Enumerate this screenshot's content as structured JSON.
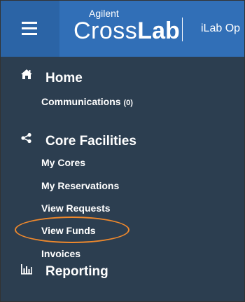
{
  "header": {
    "brand_small": "Agilent",
    "brand_light": "Cross",
    "brand_bold": "Lab",
    "app_title": "iLab Op",
    "menu_icon": "hamburger-menu-icon",
    "colors": {
      "header_bg": "#316fb7",
      "menu_button_bg": "#2b64a6",
      "text": "#ffffff"
    }
  },
  "sidebar": {
    "colors": {
      "bg": "#2c3e50",
      "text": "#ffffff",
      "highlight": "#f0892c"
    },
    "sections": [
      {
        "label": "Home",
        "icon": "home-icon",
        "items": [
          {
            "label": "Communications",
            "count": "(0)"
          }
        ]
      },
      {
        "label": "Core Facilities",
        "icon": "share-icon",
        "items": [
          {
            "label": "My Cores"
          },
          {
            "label": "My Reservations"
          },
          {
            "label": "View Requests"
          },
          {
            "label": "View Funds",
            "highlighted": true
          },
          {
            "label": "Invoices"
          }
        ]
      },
      {
        "label": "Reporting",
        "icon": "bar-chart-icon",
        "items": []
      }
    ]
  }
}
